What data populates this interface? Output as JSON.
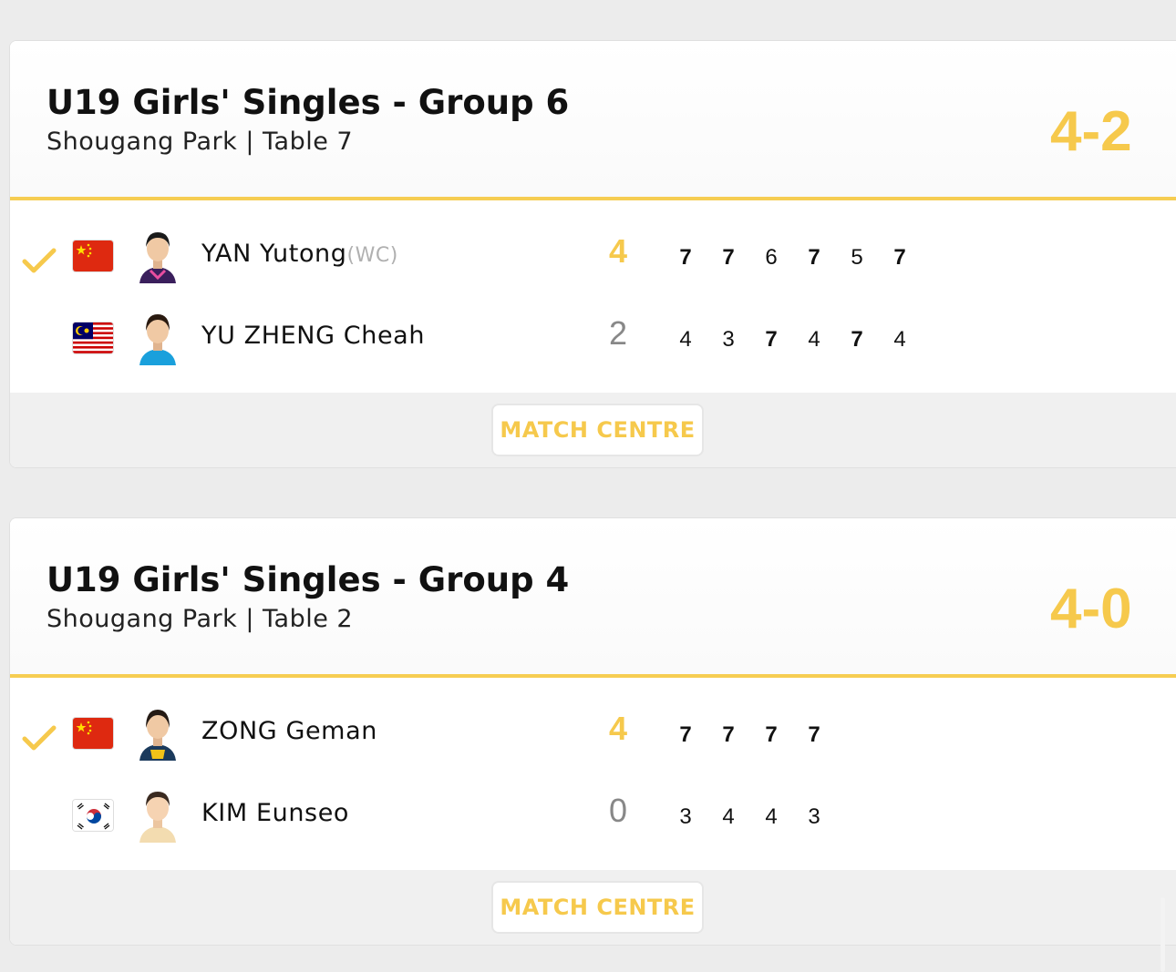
{
  "matches": [
    {
      "title": "U19 Girls' Singles - Group 6",
      "venue": "Shougang Park | Table 7",
      "final_score": "4-2",
      "button_label": "MATCH CENTRE",
      "players": [
        {
          "name": "YAN Yutong",
          "tag": "(WC)",
          "country": "China",
          "sets": "4",
          "winner": true,
          "games": [
            "7",
            "7",
            "6",
            "7",
            "5",
            "7"
          ]
        },
        {
          "name": "YU ZHENG Cheah",
          "tag": "",
          "country": "Malaysia",
          "sets": "2",
          "winner": false,
          "games": [
            "4",
            "3",
            "7",
            "4",
            "7",
            "4"
          ]
        }
      ]
    },
    {
      "title": "U19 Girls' Singles - Group 4",
      "venue": "Shougang Park | Table 2",
      "final_score": "4-0",
      "button_label": "MATCH CENTRE",
      "players": [
        {
          "name": "ZONG Geman",
          "tag": "",
          "country": "China",
          "sets": "4",
          "winner": true,
          "games": [
            "7",
            "7",
            "7",
            "7"
          ]
        },
        {
          "name": "KIM Eunseo",
          "tag": "",
          "country": "Korea",
          "sets": "0",
          "winner": false,
          "games": [
            "3",
            "4",
            "4",
            "3"
          ]
        }
      ]
    }
  ],
  "colors": {
    "accent": "#f6c94c",
    "divider": "#f6cd52",
    "footer_bg": "#f0f0f0"
  },
  "icons": {
    "winner": "checkmark-icon"
  }
}
